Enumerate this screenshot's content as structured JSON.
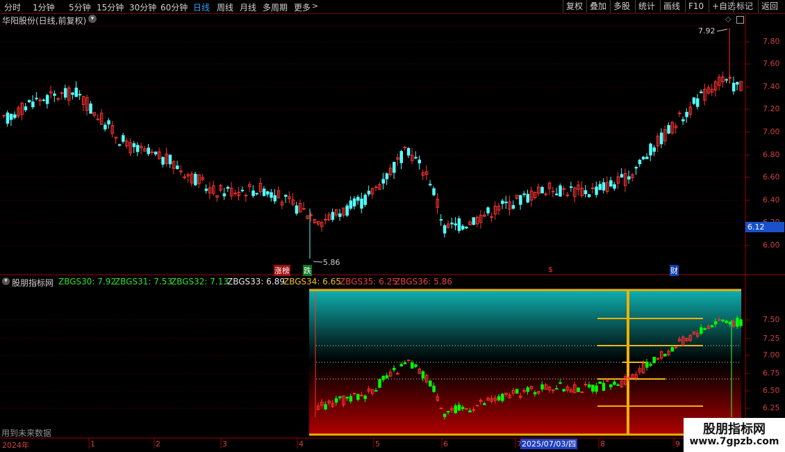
{
  "toolbar": {
    "periods": [
      {
        "label": "分时",
        "active": false
      },
      {
        "label": "1分钟",
        "active": false
      },
      {
        "label": "5分钟",
        "active": false
      },
      {
        "label": "15分钟",
        "active": false
      },
      {
        "label": "30分钟",
        "active": false
      },
      {
        "label": "60分钟",
        "active": false
      },
      {
        "label": "日线",
        "active": true
      },
      {
        "label": "周线",
        "active": false
      },
      {
        "label": "月线",
        "active": false
      },
      {
        "label": "多周期",
        "active": false
      },
      {
        "label": "更多",
        "active": false
      }
    ],
    "buttons": [
      "复权",
      "叠加",
      "多股",
      "统计",
      "画线",
      "F10",
      "+自选",
      "标记",
      "返回"
    ]
  },
  "main_chart": {
    "title": "华阳股份(日线,前复权)",
    "y_ticks": [
      "7.80",
      "7.60",
      "7.40",
      "7.20",
      "7.00",
      "6.80",
      "6.60",
      "6.40",
      "6.20",
      "6.00"
    ],
    "current_price": "6.12",
    "high_marker": "7.92",
    "low_marker": "5.86",
    "event_labels": {
      "zhangbang": "涨榜",
      "die": "跌",
      "dollar": "$",
      "cai": "财"
    }
  },
  "indicator": {
    "name": "股朋指标网",
    "values": [
      {
        "label": "ZBGS30: 7.92",
        "color": "#30e030"
      },
      {
        "label": "ZBGS31: 7.53",
        "color": "#30e030"
      },
      {
        "label": "ZBGS32: 7.13",
        "color": "#30e030"
      },
      {
        "label": "ZBGS33: 6.89",
        "color": "#e8e8e8"
      },
      {
        "label": "ZBGS34: 6.65",
        "color": "#f0c020"
      },
      {
        "label": "ZBGS35: 6.25",
        "color": "#e84040"
      },
      {
        "label": "ZBGS36: 5.86",
        "color": "#e84040"
      }
    ],
    "y_ticks": [
      "7.50",
      "7.25",
      "7.00",
      "6.75",
      "6.50",
      "6.25"
    ],
    "future_data_note": "用到未来数据"
  },
  "x_axis": {
    "labels": [
      "2024年",
      "1",
      "2",
      "3",
      "4",
      "5",
      "6",
      "7",
      "8",
      "9"
    ],
    "cursor_date": "2025/07/03/四"
  },
  "watermark": {
    "title": "股朋指标网",
    "url": "www.7gpzb.com"
  },
  "colors": {
    "up": "#ff3232",
    "down": "#54ffff",
    "axis": "#a00000",
    "indicator_up": "#ff3232",
    "indicator_down": "#00ff00",
    "highlight": "#f0b000"
  }
}
